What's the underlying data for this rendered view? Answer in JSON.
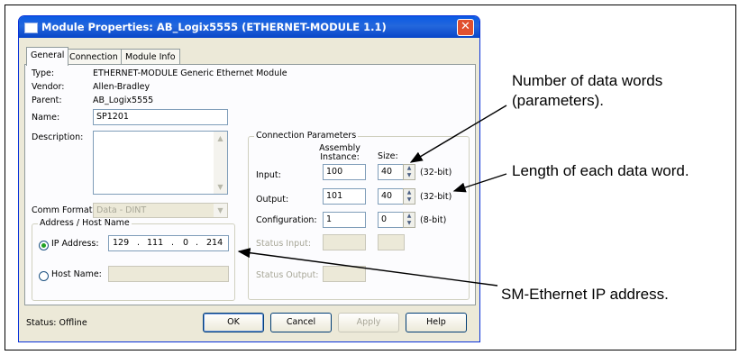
{
  "window": {
    "title": "Module Properties: AB_Logix5555 (ETHERNET-MODULE 1.1)",
    "close_glyph": "✕"
  },
  "tabs": [
    "General",
    "Connection",
    "Module Info"
  ],
  "general": {
    "type_label": "Type:",
    "type_value": "ETHERNET-MODULE Generic Ethernet Module",
    "vendor_label": "Vendor:",
    "vendor_value": "Allen-Bradley",
    "parent_label": "Parent:",
    "parent_value": "AB_Logix5555",
    "name_label": "Name:",
    "name_value": "SP1201",
    "description_label": "Description:",
    "comm_format_label": "Comm Format:",
    "comm_format_value": "Data - DINT"
  },
  "address": {
    "group_label": "Address / Host Name",
    "ip_label": "IP Address:",
    "ip_octets": [
      "129",
      "111",
      "0",
      "214"
    ],
    "dot": ".",
    "host_label": "Host Name:"
  },
  "connection": {
    "group_label": "Connection Parameters",
    "assembly_header_1": "Assembly",
    "assembly_header_2": "Instance:",
    "size_header": "Size:",
    "input_label": "Input:",
    "input_instance": "100",
    "input_size": "40",
    "input_unit": "(32-bit)",
    "output_label": "Output:",
    "output_instance": "101",
    "output_size": "40",
    "output_unit": "(32-bit)",
    "config_label": "Configuration:",
    "config_instance": "1",
    "config_size": "0",
    "config_unit": "(8-bit)",
    "status_input_label": "Status Input:",
    "status_output_label": "Status Output:"
  },
  "footer": {
    "status": "Status:  Offline",
    "ok": "OK",
    "cancel": "Cancel",
    "apply": "Apply",
    "help": "Help"
  },
  "annotations": {
    "words_line1": "Number of data words",
    "words_line2": "(parameters).",
    "length": "Length of each data word.",
    "ip": "SM-Ethernet IP address."
  },
  "icons": [
    "window-icon",
    "close-icon",
    "scroll-up-icon",
    "scroll-down-icon",
    "dropdown-arrow-icon",
    "spin-up-icon",
    "spin-down-icon"
  ],
  "colors": {
    "titlebar": "#0a5ae4",
    "close": "#e0502f",
    "dialog_bg": "#ece9d8"
  }
}
